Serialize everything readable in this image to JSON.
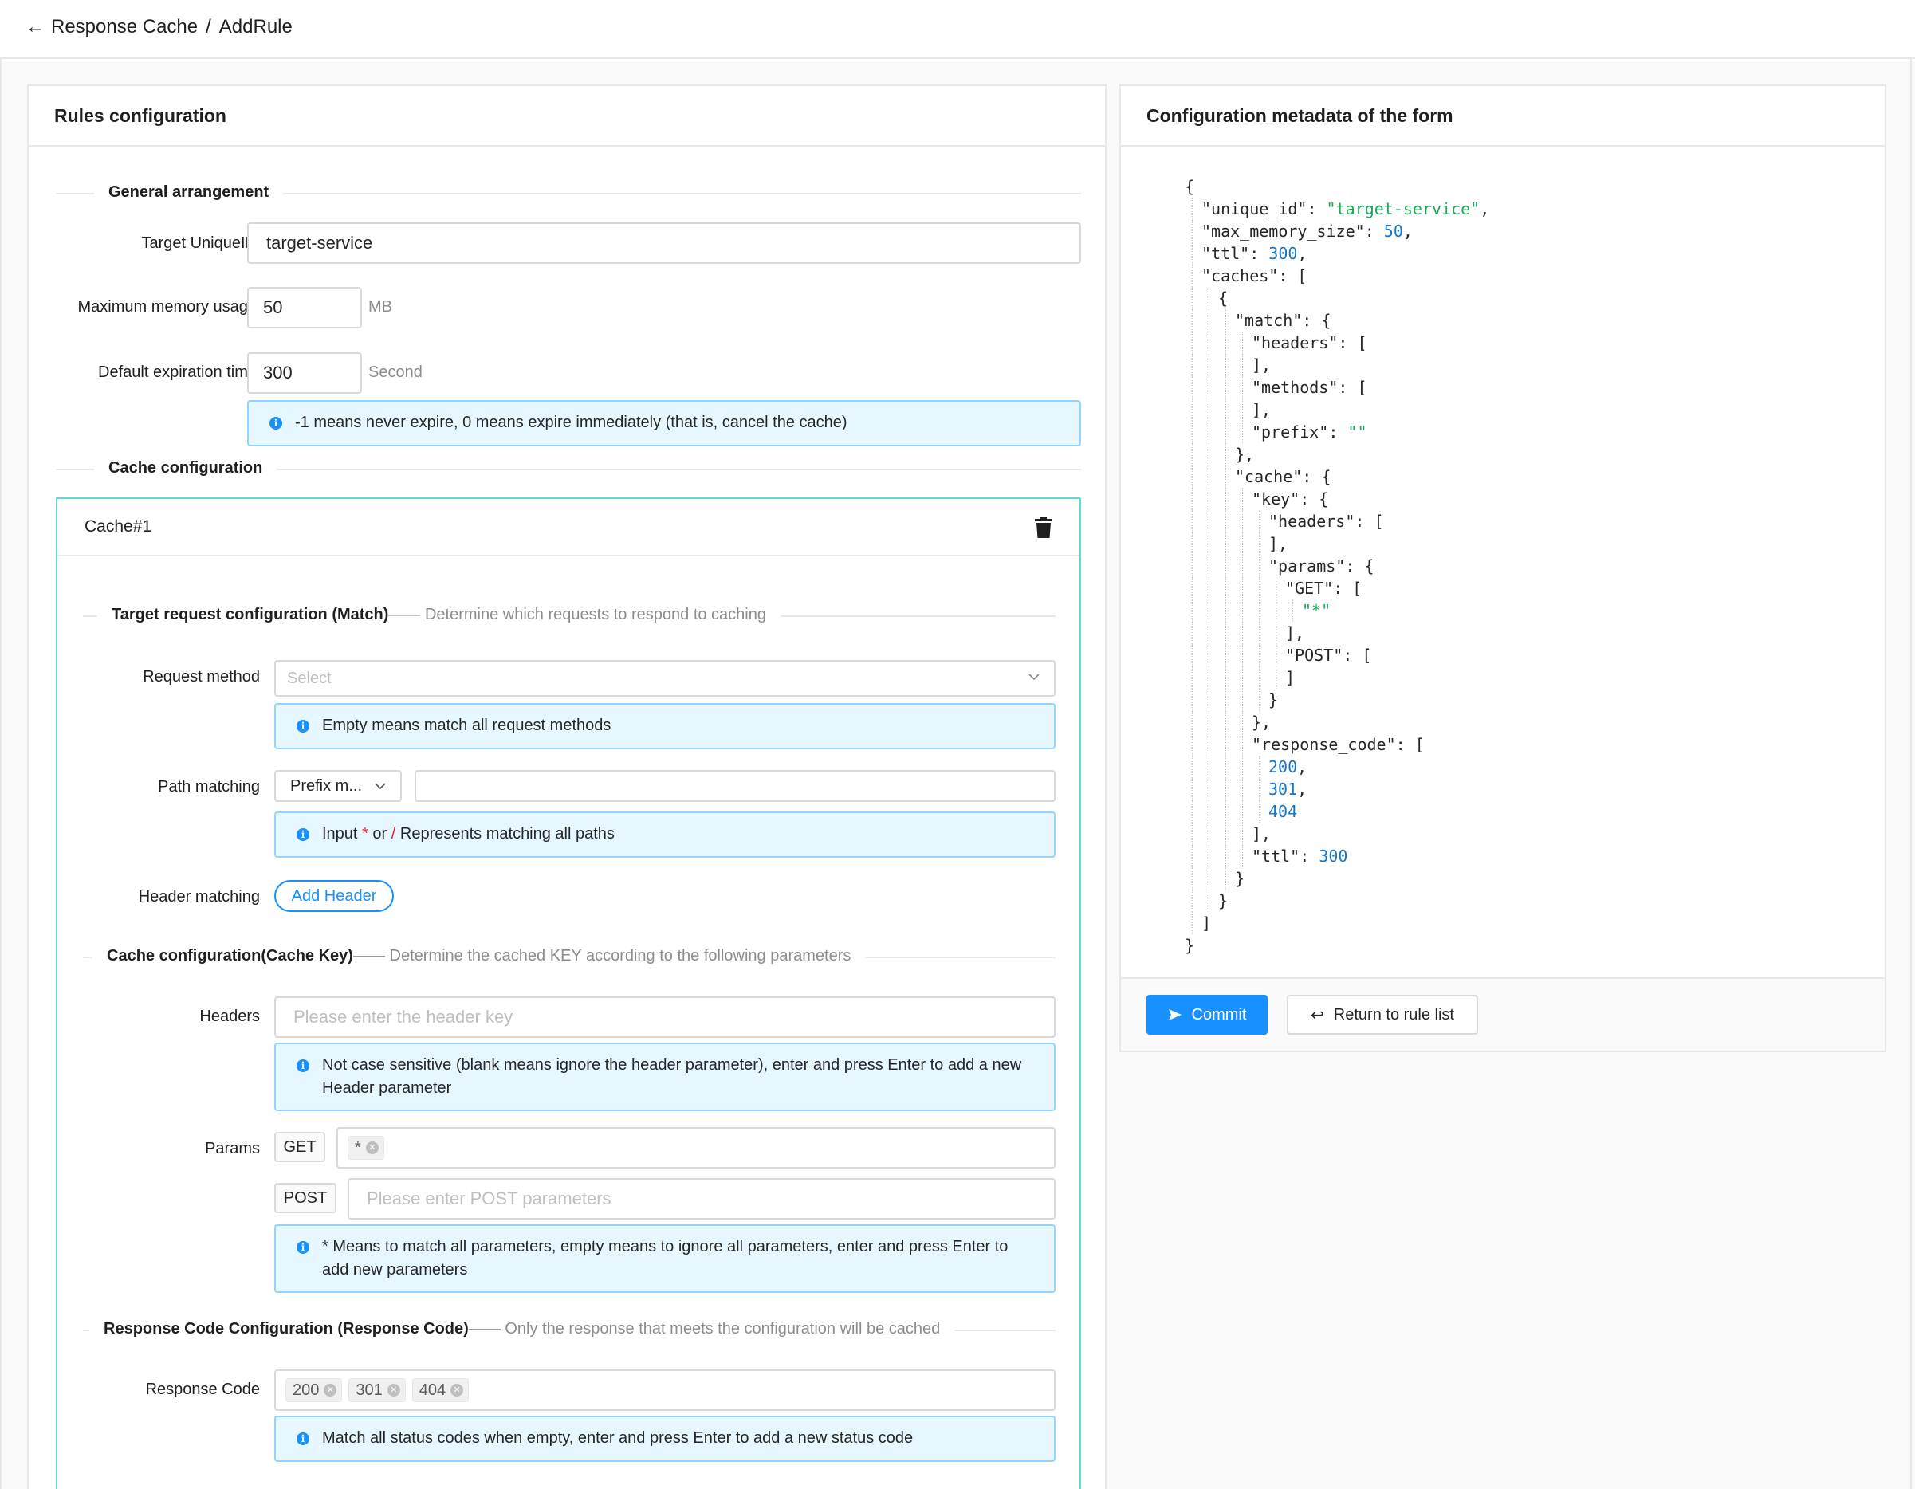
{
  "breadcrumb": {
    "parent": "Response Cache",
    "separator": "/",
    "current": "AddRule"
  },
  "left_card": {
    "title": "Rules configuration",
    "general": {
      "title": "General arrangement",
      "target_label": "Target UniqueID",
      "target_value": "target-service",
      "memory_label": "Maximum memory usage",
      "memory_value": "50",
      "memory_unit": "MB",
      "expire_label": "Default expiration time",
      "expire_value": "300",
      "expire_unit": "Second",
      "expire_tip": "-1 means never expire, 0 means expire immediately (that is, cancel the cache)"
    },
    "cache_config_title": "Cache configuration",
    "cache_item": {
      "title": "Cache#1",
      "match_section": {
        "title": "Target request configuration (Match)",
        "subtitle": "—— Determine which requests to respond to caching"
      },
      "method_label": "Request method",
      "method_placeholder": "Select",
      "method_tip": "Empty means match all request methods",
      "path_label": "Path matching",
      "path_mode": "Prefix m...",
      "path_value": "",
      "path_tip_a": "Input",
      "path_tip_star": "*",
      "path_tip_or": "or",
      "path_tip_slash": "/",
      "path_tip_b": "Represents matching all paths",
      "header_label": "Header matching",
      "add_header": "Add Header",
      "key_section": {
        "title": "Cache configuration(Cache Key)",
        "subtitle": "—— Determine the cached KEY according to the following parameters"
      },
      "headers_label": "Headers",
      "headers_placeholder": "Please enter the header key",
      "headers_tip": "Not case sensitive (blank means ignore the header parameter), enter and press Enter to add a new Header parameter",
      "params_label": "Params",
      "get_tag": "GET",
      "get_values": [
        "*"
      ],
      "post_tag": "POST",
      "post_placeholder": "Please enter POST parameters",
      "params_tip": "* Means to match all parameters, empty means to ignore all parameters, enter and press Enter to add new parameters",
      "code_section": {
        "title": "Response Code Configuration (Response Code)",
        "subtitle": "—— Only the response that meets the configuration will be cached"
      },
      "code_label": "Response Code",
      "codes": [
        "200",
        "301",
        "404"
      ],
      "code_tip": "Match all status codes when empty, enter and press Enter to add a new status code"
    }
  },
  "right_card": {
    "title": "Configuration metadata of the form",
    "commit": "Commit",
    "return": "Return to rule list"
  },
  "json_lines": [
    [
      {
        "t": "{"
      }
    ],
    [
      {
        "t": "\"unique_id\": "
      },
      {
        "t": "\"target-service\"",
        "c": "s"
      },
      {
        "t": ","
      }
    ],
    [
      {
        "t": "\"max_memory_size\": "
      },
      {
        "t": "50",
        "c": "n"
      },
      {
        "t": ","
      }
    ],
    [
      {
        "t": "\"ttl\": "
      },
      {
        "t": "300",
        "c": "n"
      },
      {
        "t": ","
      }
    ],
    [
      {
        "t": "\"caches\": ["
      }
    ],
    [
      {
        "t": "{"
      }
    ],
    [
      {
        "t": "\"match\": {"
      }
    ],
    [
      {
        "t": "\"headers\": ["
      }
    ],
    [
      {
        "t": "],"
      }
    ],
    [
      {
        "t": "\"methods\": ["
      }
    ],
    [
      {
        "t": "],"
      }
    ],
    [
      {
        "t": "\"prefix\": "
      },
      {
        "t": "\"\"",
        "c": "s"
      }
    ],
    [
      {
        "t": "},"
      }
    ],
    [
      {
        "t": "\"cache\": {"
      }
    ],
    [
      {
        "t": "\"key\": {"
      }
    ],
    [
      {
        "t": "\"headers\": ["
      }
    ],
    [
      {
        "t": "],"
      }
    ],
    [
      {
        "t": "\"params\": {"
      }
    ],
    [
      {
        "t": "\"GET\": ["
      }
    ],
    [
      {
        "t": "\"*\"",
        "c": "s"
      }
    ],
    [
      {
        "t": "],"
      }
    ],
    [
      {
        "t": "\"POST\": ["
      }
    ],
    [
      {
        "t": "]"
      }
    ],
    [
      {
        "t": "}"
      }
    ],
    [
      {
        "t": "},"
      }
    ],
    [
      {
        "t": "\"response_code\": ["
      }
    ],
    [
      {
        "t": "200",
        "c": "n"
      },
      {
        "t": ","
      }
    ],
    [
      {
        "t": "301",
        "c": "n"
      },
      {
        "t": ","
      }
    ],
    [
      {
        "t": "404",
        "c": "n"
      }
    ],
    [
      {
        "t": "],"
      }
    ],
    [
      {
        "t": "\"ttl\": "
      },
      {
        "t": "300",
        "c": "n"
      }
    ],
    [
      {
        "t": "}"
      }
    ],
    [
      {
        "t": "}"
      }
    ],
    [
      {
        "t": "]"
      }
    ],
    [
      {
        "t": "}"
      }
    ]
  ],
  "colors": {
    "primary": "#1890ff",
    "string": "#1aaa55",
    "number": "#1677c8",
    "cache_border": "#5cdbd3",
    "alert_bg": "#e6f7ff"
  },
  "icons": [
    "arrow-left-icon",
    "trash-icon",
    "info-icon",
    "chevron-down-icon",
    "send-icon",
    "return-icon",
    "close-circle-icon"
  ]
}
